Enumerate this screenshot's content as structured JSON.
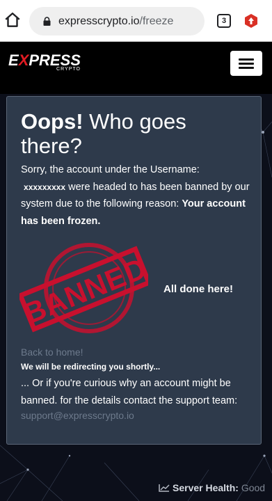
{
  "browser": {
    "url_host": "expresscrypto.io",
    "url_path": "/freeze",
    "tab_count": "3"
  },
  "header": {
    "logo_main_pre": "E",
    "logo_main_x": "X",
    "logo_main_post": "PRESS",
    "logo_sub": "CRYPTO"
  },
  "card": {
    "heading_bold": "Oops!",
    "heading_rest": " Who goes there?",
    "msg_part1": "Sorry, the account under the Username:",
    "username": "xxxxxxxxx",
    "msg_part2": " were headed to has been banned by our system due to the following reason: ",
    "reason": "Your account has been frozen.",
    "stamp_text": "BANNED",
    "done_text": "All done here!",
    "back_link": "Back to home!",
    "redirect_text": "We will be redirecting you shortly...",
    "curious_text": "... Or if you're curious why an account might be banned. for the details contact the support team:",
    "support_email": "support@expresscrypto.io"
  },
  "footer": {
    "health_label": "Server Health:",
    "health_value": "Good"
  },
  "colors": {
    "card_bg": "#2e3a4b",
    "stamp_red": "#c8102e",
    "muted_link": "#6d7a8c"
  }
}
